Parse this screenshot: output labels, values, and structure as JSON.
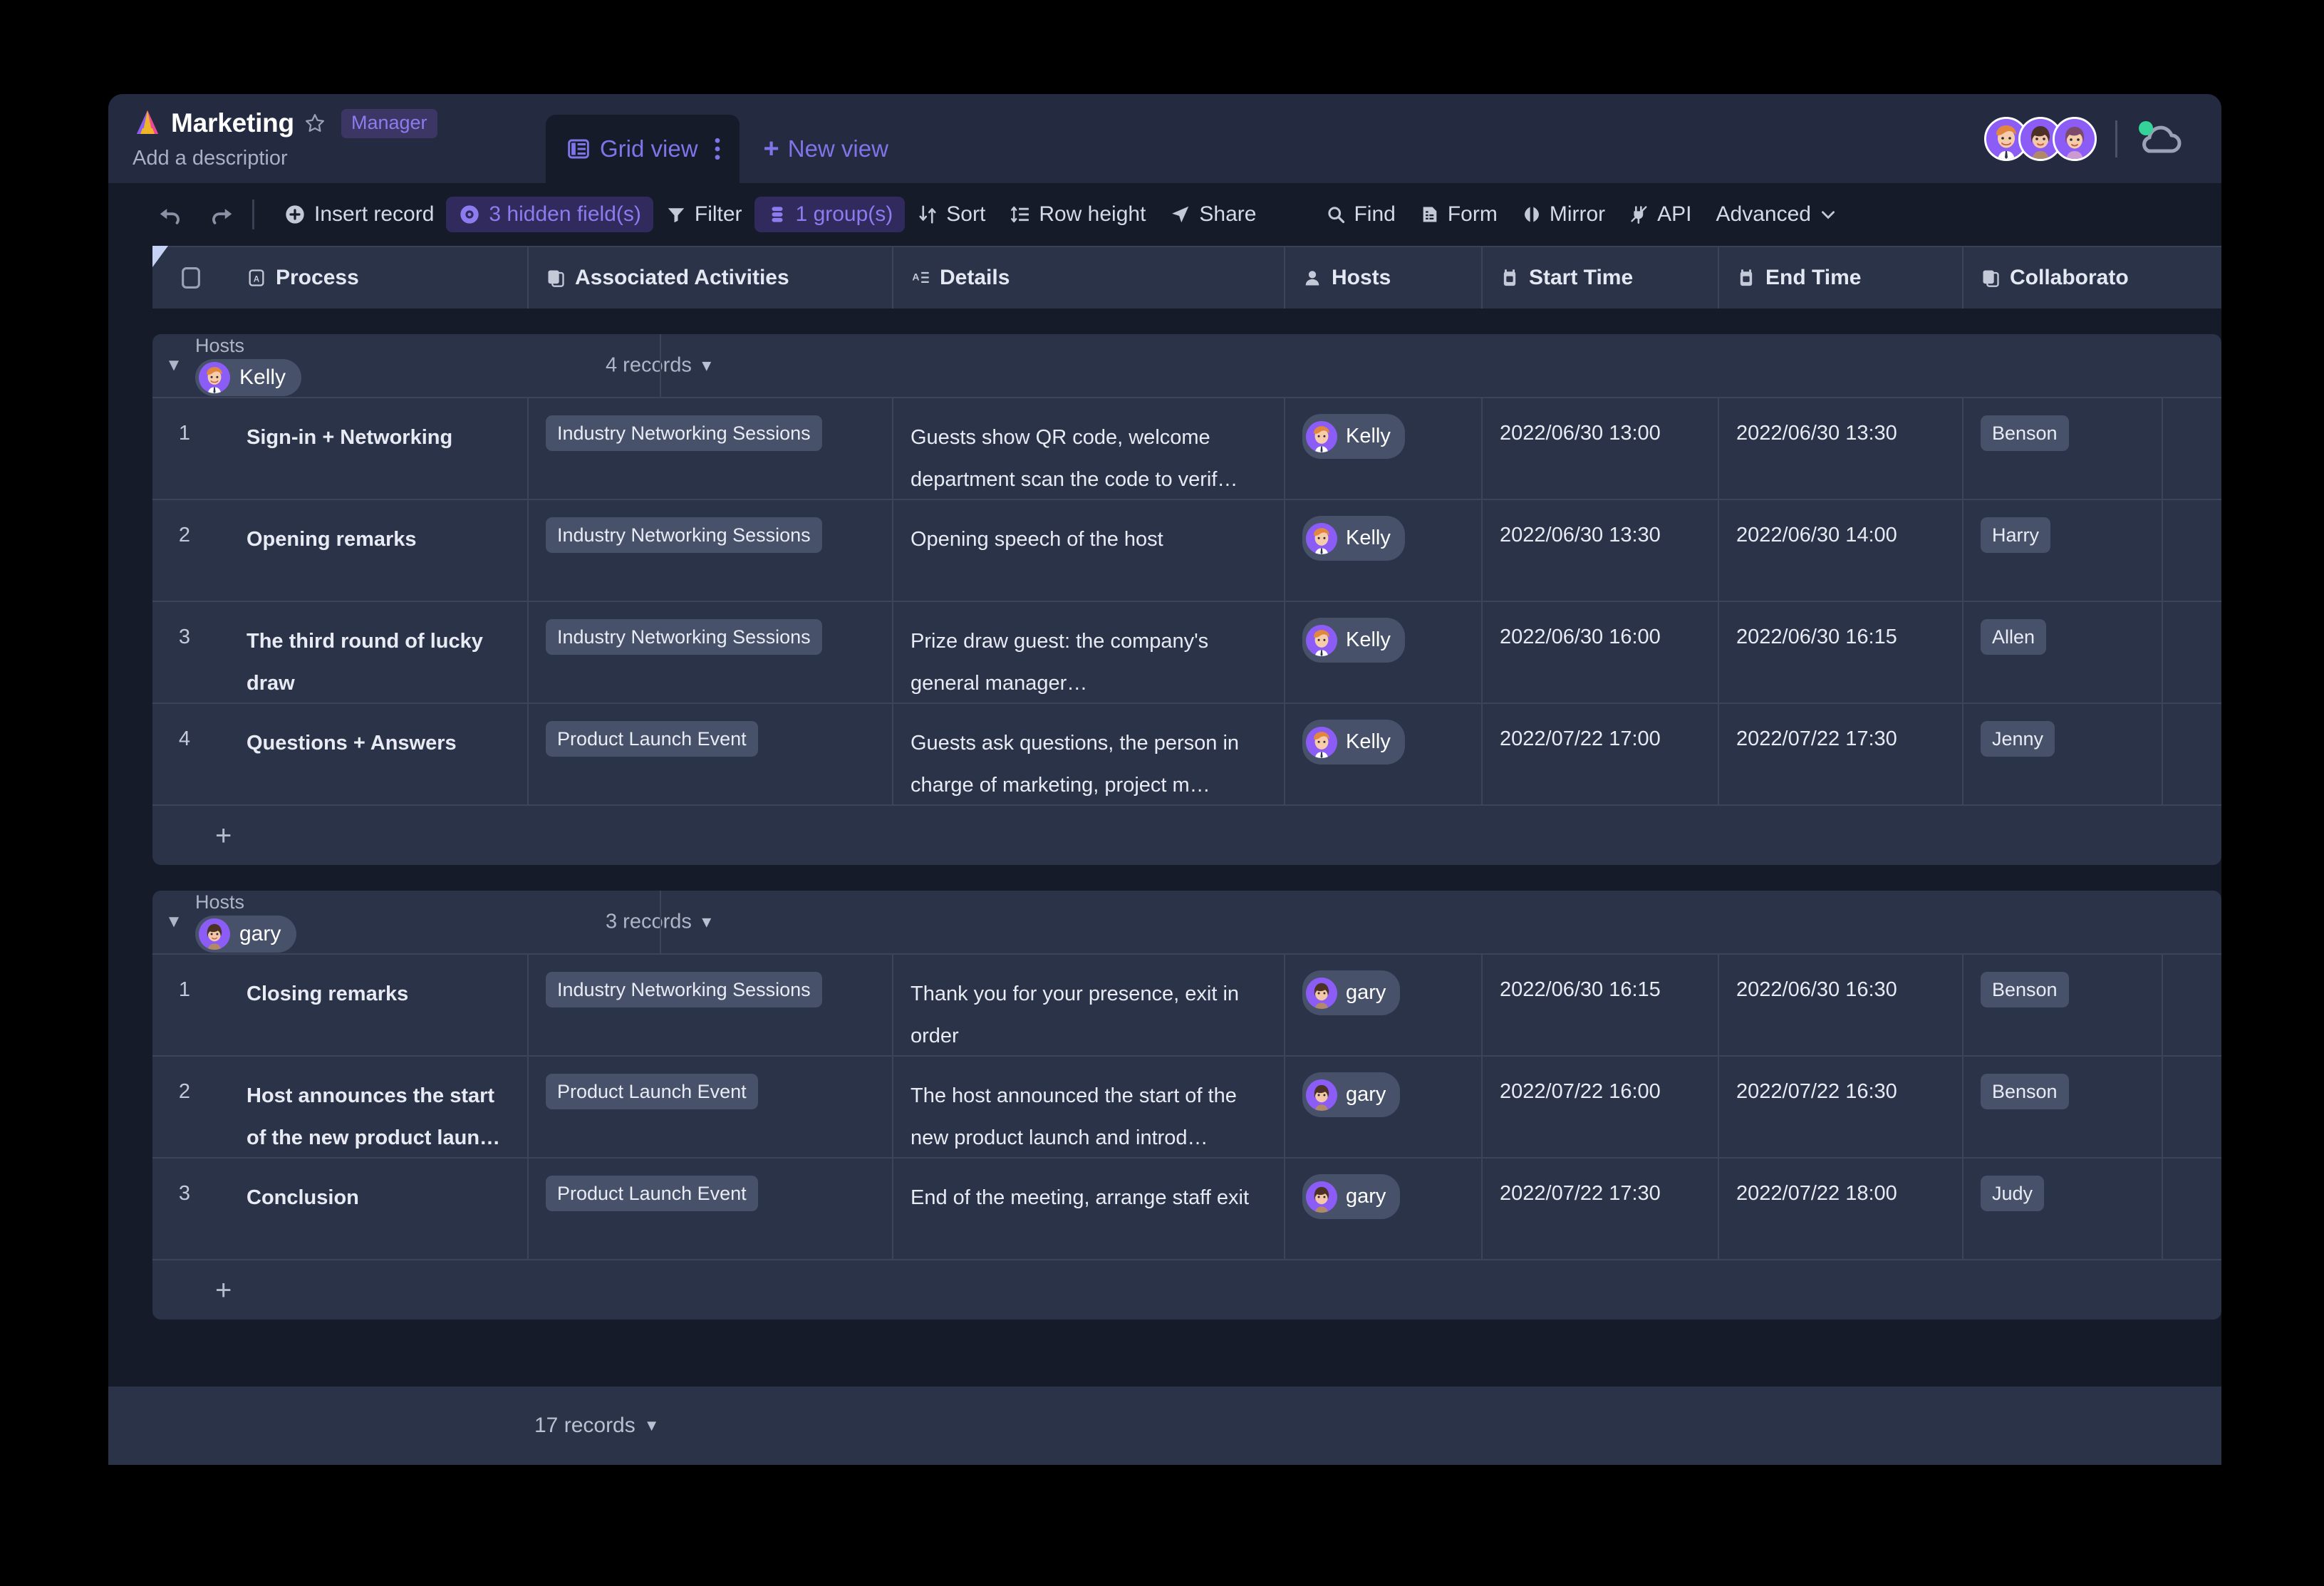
{
  "header": {
    "logo_icon": "triangle-logo-icon",
    "app_title": "Marketing",
    "star_icon": "star-icon",
    "badge": "Manager",
    "description_placeholder": "Add a descriptior",
    "tabs": [
      {
        "label": "Grid view",
        "icon": "grid-view-icon",
        "active": true
      }
    ],
    "new_view_label": "New view",
    "new_view_icon": "plus-icon",
    "collaborator_avatars": [
      "avatar-kelly",
      "avatar-gary",
      "avatar-jenny"
    ],
    "cloud_icon": "cloud-sync-icon",
    "cloud_status_color": "#35d399"
  },
  "toolbar": {
    "undo_icon": "undo-icon",
    "redo_icon": "redo-icon",
    "items": [
      {
        "label": "Insert record",
        "icon": "plus-circle-icon",
        "active": false
      },
      {
        "label": "3 hidden field(s)",
        "icon": "eye-icon",
        "active": true
      },
      {
        "label": "Filter",
        "icon": "filter-icon",
        "active": false
      },
      {
        "label": "1 group(s)",
        "icon": "group-icon",
        "active": true
      },
      {
        "label": "Sort",
        "icon": "sort-icon",
        "active": false
      },
      {
        "label": "Row height",
        "icon": "row-height-icon",
        "active": false
      },
      {
        "label": "Share",
        "icon": "share-icon",
        "active": false
      }
    ],
    "right_items": [
      {
        "label": "Find",
        "icon": "search-icon"
      },
      {
        "label": "Form",
        "icon": "form-icon"
      },
      {
        "label": "Mirror",
        "icon": "mirror-icon"
      },
      {
        "label": "API",
        "icon": "api-icon"
      },
      {
        "label": "Advanced",
        "icon": "chevron-down-icon"
      }
    ]
  },
  "grid": {
    "columns": [
      {
        "label": "Process",
        "icon": "text-field-icon"
      },
      {
        "label": "Associated Activities",
        "icon": "link-field-icon"
      },
      {
        "label": "Details",
        "icon": "long-text-icon"
      },
      {
        "label": "Hosts",
        "icon": "user-field-icon"
      },
      {
        "label": "Start Time",
        "icon": "date-field-icon"
      },
      {
        "label": "End Time",
        "icon": "date-field-icon"
      },
      {
        "label": "Collaborato",
        "icon": "link-field-icon"
      }
    ],
    "groups": [
      {
        "field_label": "Hosts",
        "value": "Kelly",
        "avatar": "avatar-kelly",
        "records_label": "4 records",
        "rows": [
          {
            "num": "1",
            "process": "Sign-in + Networking",
            "activity": "Industry Networking Sessions",
            "details": "Guests show QR code, welcome department scan the code to verif…",
            "host": "Kelly",
            "host_avatar": "avatar-kelly",
            "start": "2022/06/30 13:00",
            "end": "2022/06/30 13:30",
            "collaborator": "Benson"
          },
          {
            "num": "2",
            "process": "Opening remarks",
            "activity": "Industry Networking Sessions",
            "details": "Opening speech of the host",
            "host": "Kelly",
            "host_avatar": "avatar-kelly",
            "start": "2022/06/30 13:30",
            "end": "2022/06/30 14:00",
            "collaborator": "Harry"
          },
          {
            "num": "3",
            "process": "The third round of lucky draw",
            "activity": "Industry Networking Sessions",
            "details": "Prize draw guest: the company's general manager…",
            "host": "Kelly",
            "host_avatar": "avatar-kelly",
            "start": "2022/06/30 16:00",
            "end": "2022/06/30 16:15",
            "collaborator": "Allen"
          },
          {
            "num": "4",
            "process": "Questions + Answers",
            "activity": "Product Launch Event",
            "details": "Guests ask questions, the person in charge of marketing, project m…",
            "host": "Kelly",
            "host_avatar": "avatar-kelly",
            "start": "2022/07/22 17:00",
            "end": "2022/07/22 17:30",
            "collaborator": "Jenny"
          }
        ]
      },
      {
        "field_label": "Hosts",
        "value": "gary",
        "avatar": "avatar-gary",
        "records_label": "3 records",
        "rows": [
          {
            "num": "1",
            "process": "Closing remarks",
            "activity": "Industry Networking Sessions",
            "details": "Thank you for your presence, exit in order",
            "host": "gary",
            "host_avatar": "avatar-gary",
            "start": "2022/06/30 16:15",
            "end": "2022/06/30 16:30",
            "collaborator": "Benson"
          },
          {
            "num": "2",
            "process": "Host announces the start of the new product laun…",
            "activity": "Product Launch Event",
            "details": "The host announced the start of the new product launch and introd…",
            "host": "gary",
            "host_avatar": "avatar-gary",
            "start": "2022/07/22 16:00",
            "end": "2022/07/22 16:30",
            "collaborator": "Benson"
          },
          {
            "num": "3",
            "process": "Conclusion",
            "activity": "Product Launch Event",
            "details": "End of the meeting, arrange staff exit",
            "host": "gary",
            "host_avatar": "avatar-gary",
            "start": "2022/07/22 17:30",
            "end": "2022/07/22 18:00",
            "collaborator": "Judy"
          }
        ]
      }
    ],
    "add_row_icon": "plus-icon"
  },
  "footer": {
    "records_label": "17 records",
    "caret_icon": "chevron-down-icon"
  }
}
